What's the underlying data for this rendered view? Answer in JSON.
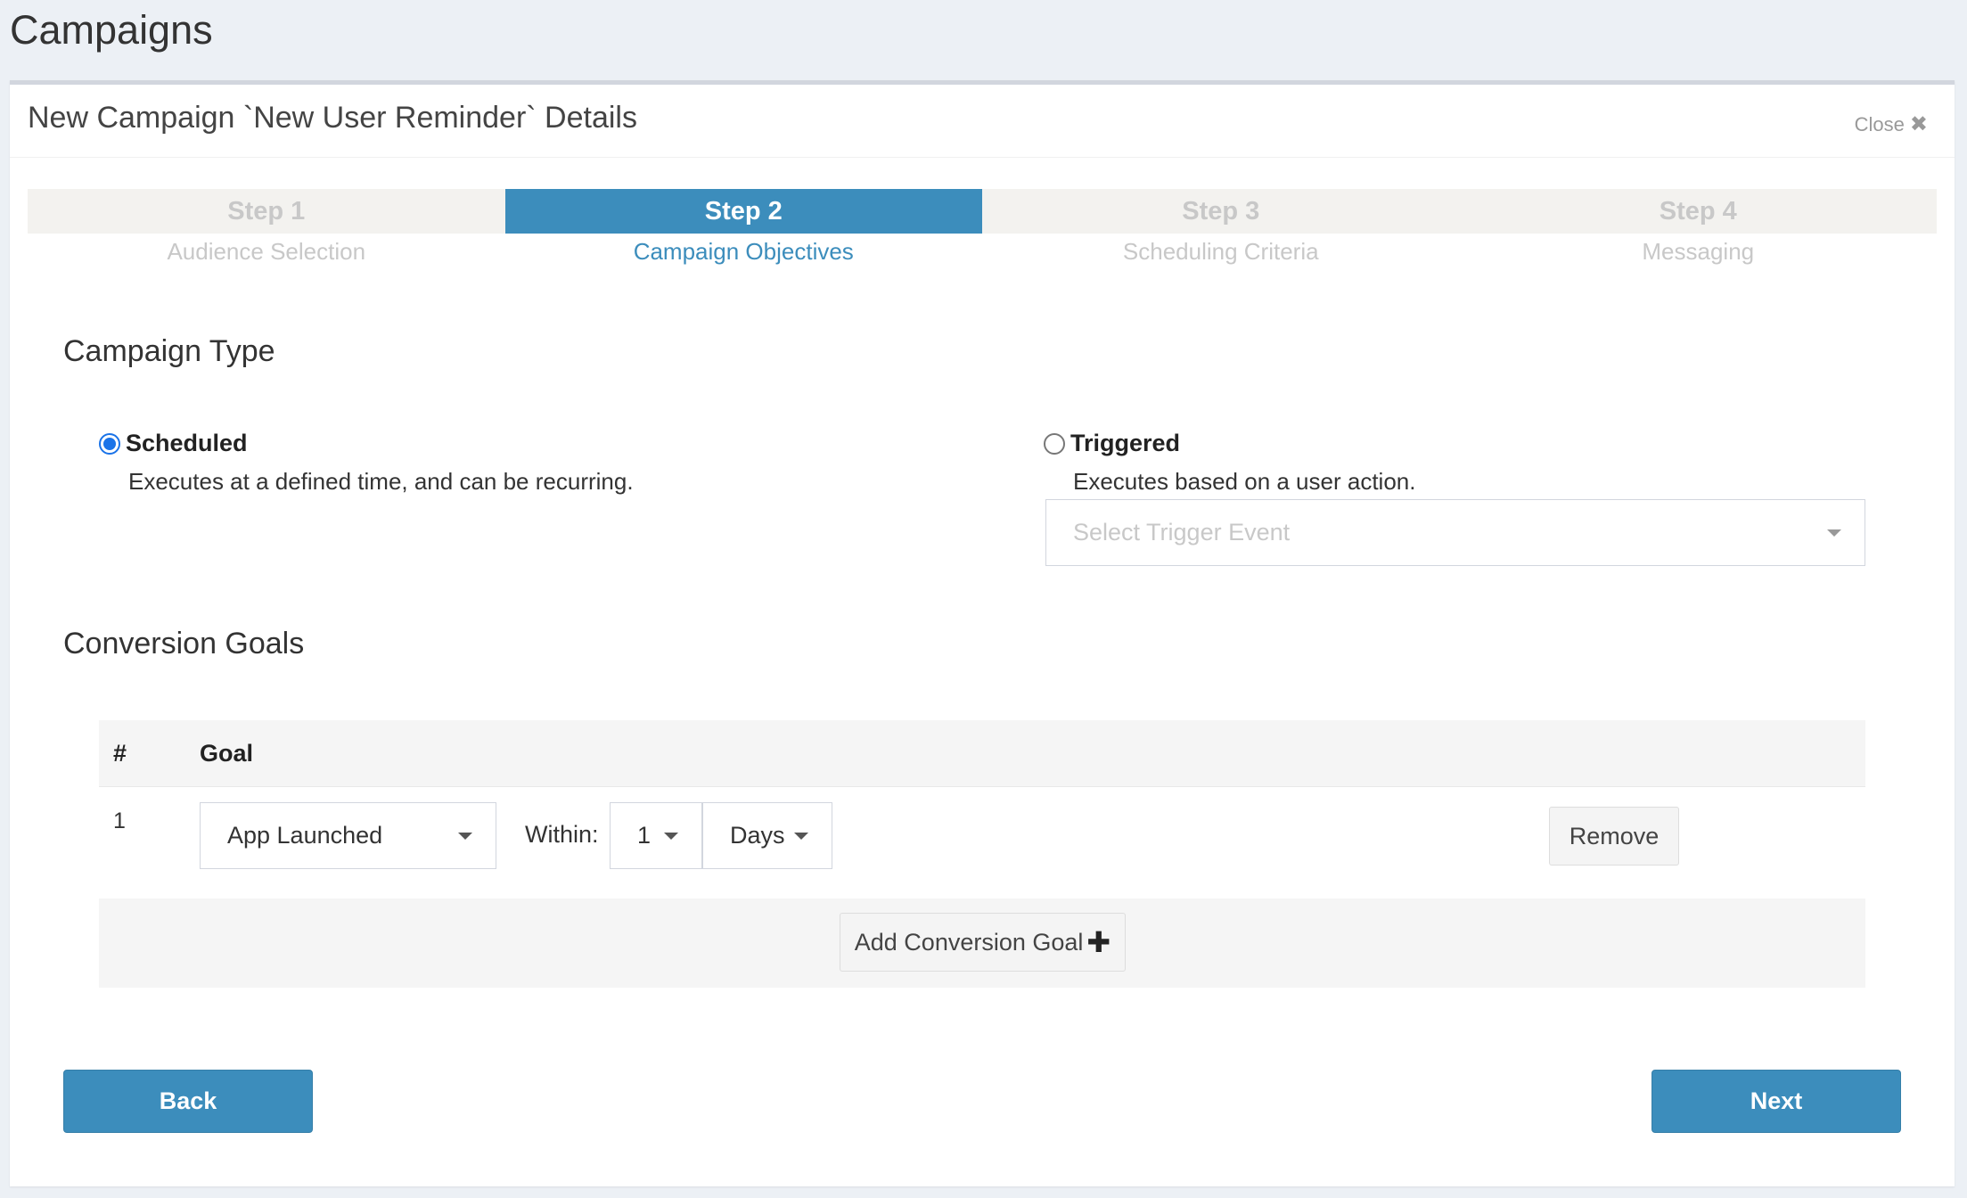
{
  "page": {
    "title": "Campaigns"
  },
  "panel": {
    "title": "New Campaign `New User Reminder` Details",
    "close_label": "Close",
    "close_icon": "✖"
  },
  "steps": [
    {
      "num": "Step 1",
      "label": "Audience Selection",
      "active": false
    },
    {
      "num": "Step 2",
      "label": "Campaign Objectives",
      "active": true
    },
    {
      "num": "Step 3",
      "label": "Scheduling Criteria",
      "active": false
    },
    {
      "num": "Step 4",
      "label": "Messaging",
      "active": false
    }
  ],
  "campaign_type": {
    "title": "Campaign Type",
    "scheduled": {
      "label": "Scheduled",
      "desc": "Executes at a defined time, and can be recurring.",
      "checked": true
    },
    "triggered": {
      "label": "Triggered",
      "desc": "Executes based on a user action.",
      "checked": false
    },
    "trigger_select": {
      "placeholder": "Select Trigger Event"
    }
  },
  "conversion_goals": {
    "title": "Conversion Goals",
    "headers": {
      "num": "#",
      "goal": "Goal"
    },
    "rows": [
      {
        "num": "1",
        "goal": "App Launched",
        "within_label": "Within:",
        "within_value": "1",
        "unit": "Days",
        "remove_label": "Remove"
      }
    ],
    "add_label": "Add Conversion Goal",
    "add_icon": "✚"
  },
  "nav": {
    "back_label": "Back",
    "next_label": "Next"
  },
  "colors": {
    "primary": "#3c8dbc",
    "background": "#ecf0f5",
    "radio_checked": "#1a73e8"
  }
}
